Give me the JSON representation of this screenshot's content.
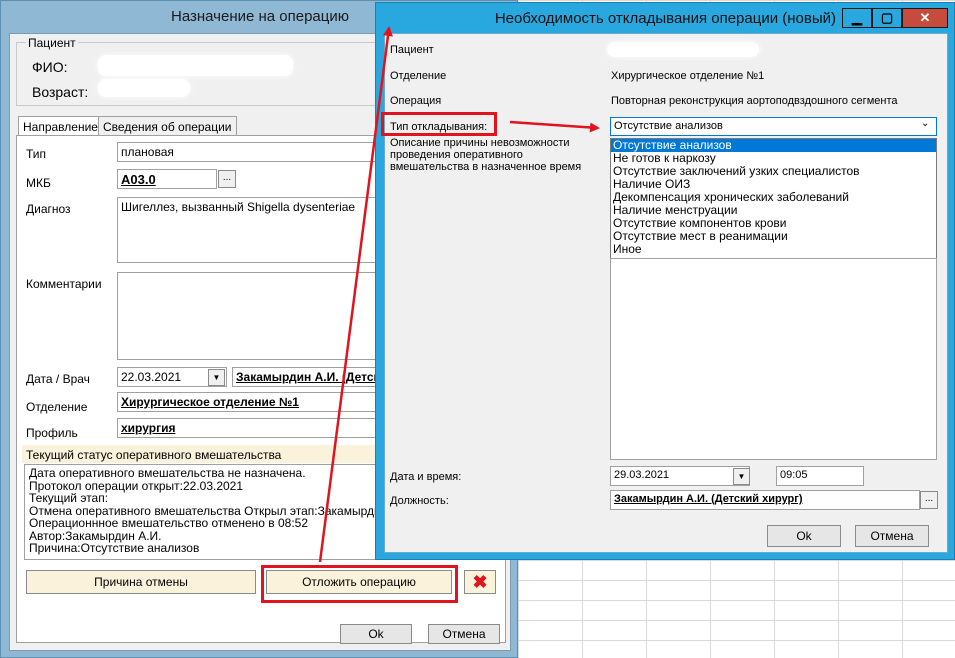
{
  "back_window": {
    "title": "Назначение на операцию",
    "patient_group": "Пациент",
    "fio_label": "ФИО:",
    "age_label": "Возраст:",
    "tabs": [
      {
        "label": "Направление"
      },
      {
        "label": "Сведения об операции"
      }
    ],
    "type_label": "Тип",
    "type_value": "плановая",
    "mkb_label": "МКБ",
    "mkb_value": "A03.0",
    "browse_label": "...",
    "diagnosis_label": "Диагноз",
    "diagnosis_value": "Шигеллез, вызванный Shigella dysenteriae",
    "comments_label": "Комментарии",
    "date_doctor_label": "Дата / Врач",
    "date_value": "22.03.2021",
    "doctor_value": "Закамырдин А.И. (Детск",
    "department_label": "Отделение",
    "department_value": "Хирургическое отделение №1",
    "profile_label": "Профиль",
    "profile_value": "хирургия",
    "status_header": "Текущий статус оперативного вмешательства",
    "status_lines": [
      "Дата оперативного вмешательства не назначена.",
      "Протокол операции открыт:22.03.2021",
      "Текущий этап:",
      "Отмена оперативного вмешательства Открыл этап:Закамырдин А.И.",
      "Операционнное вмешательство отменено в 08:52",
      "Автор:Закамырдин А.И.",
      "Причина:Отсутствие анализов"
    ],
    "cancel_reason_button": "Причина отмены",
    "postpone_button": "Отложить операцию",
    "ok_button": "Ok",
    "cancel_button": "Отмена"
  },
  "front_window": {
    "title": "Необходимость откладывания операции (новый)",
    "patient_label": "Пациент",
    "department_label": "Отделение",
    "department_value": "Хирургическое отделение №1",
    "operation_label": "Операция",
    "operation_value": "Повторная реконструкция аортоподвздошного сегмента",
    "postpone_type_label": "Тип откладывания:",
    "description_label": "Описание причины невозможности проведения оперативного вмешательства в назначенное время",
    "selected_value": "Отсутствие анализов",
    "options": [
      "Отсутствие анализов",
      "Не готов к наркозу",
      "Отсутствие заключений узких специалистов",
      "Наличие ОИЗ",
      "Декомпенсация хронических заболеваний",
      "Наличие менструации",
      "Отсутствие компонентов крови",
      "Отсутствие мест в реанимации",
      "Иное"
    ],
    "datetime_label": "Дата и время:",
    "date_value": "29.03.2021",
    "time_value": "09:05",
    "position_label": "Должность:",
    "position_value": "Закамырдин А.И. (Детский хирург)",
    "browse_label": "...",
    "ok_button": "Ok",
    "cancel_button": "Отмена"
  },
  "colors": {
    "highlight_red": "#e0141e",
    "list_selection": "#0078d7",
    "title_bar_active": "#29a8e0",
    "close_button": "#c74b3c"
  }
}
